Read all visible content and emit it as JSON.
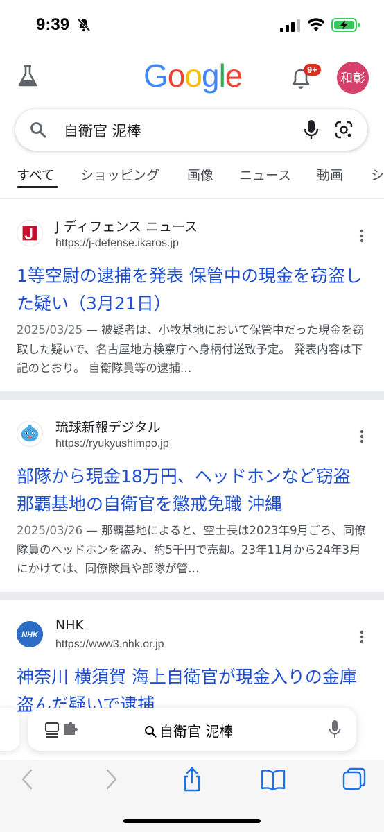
{
  "status_bar": {
    "time": "9:39",
    "icons": [
      "bell-muted-icon",
      "cellular-signal-icon",
      "wifi-icon",
      "battery-charging-icon"
    ]
  },
  "header": {
    "logo_letters": [
      {
        "ch": "G",
        "color": "#4285F4"
      },
      {
        "ch": "o",
        "color": "#EA4335"
      },
      {
        "ch": "o",
        "color": "#FBBC05"
      },
      {
        "ch": "g",
        "color": "#4285F4"
      },
      {
        "ch": "l",
        "color": "#34A853"
      },
      {
        "ch": "e",
        "color": "#EA4335"
      }
    ],
    "notification_badge": "9+",
    "avatar_text": "和彰",
    "avatar_color": "#d63f6b"
  },
  "search": {
    "query": "自衛官 泥棒"
  },
  "tabs": [
    "すべて",
    "ショッピング",
    "画像",
    "ニュース",
    "動画",
    "シ"
  ],
  "results": [
    {
      "site": "J ディフェンス ニュース",
      "url": "https://j-defense.ikaros.jp",
      "title": "1等空尉の逮捕を発表 保管中の現金を窃盗した疑い（3月21日）",
      "date": "2025/03/25",
      "snippet": "被疑者は、小牧基地において保管中だった現金を窃取した疑いで、名古屋地方検察庁へ身柄付送致予定。 発表内容は下記のとおり。 自衛隊員等の逮捕…",
      "favicon": "j-defense-logo-icon"
    },
    {
      "site": "琉球新報デジタル",
      "url": "https://ryukyushimpo.jp",
      "title": "部隊から現金18万円、ヘッドホンなど窃盗 那覇基地の自衛官を懲戒免職 沖縄",
      "date": "2025/03/26",
      "snippet": "那覇基地によると、空士長は2023年9月ごろ、同僚隊員のヘッドホンを盗み、約5千円で売却。23年11月から24年3月にかけては、同僚隊員や部隊が管…",
      "favicon": "ryukyu-shimpo-mascot-icon"
    },
    {
      "site": "NHK",
      "url": "https://www3.nhk.or.jp",
      "title": "神奈川 横須賀 海上自衛官が現金入りの金庫盗んだ疑いで逮捕",
      "favicon": "nhk-logo-icon"
    }
  ],
  "safari": {
    "address_query": "自衛官 泥棒",
    "toolbar_icons": [
      "back-icon",
      "forward-icon",
      "share-icon",
      "bookmarks-icon",
      "tabs-icon"
    ]
  }
}
